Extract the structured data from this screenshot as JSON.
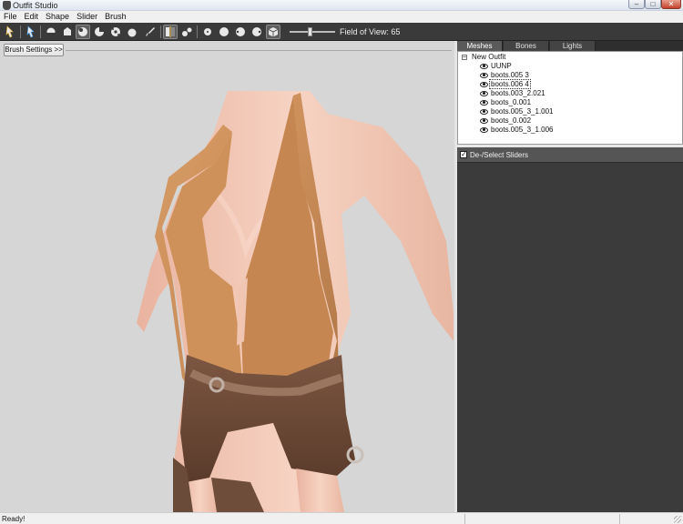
{
  "window": {
    "title": "Outfit Studio",
    "controls": [
      "–",
      "□",
      "✕"
    ]
  },
  "menu": [
    "File",
    "Edit",
    "Shape",
    "Slider",
    "Brush"
  ],
  "toolbar": {
    "fov_label": "Field of View: 65",
    "fov_value": 65
  },
  "viewport": {
    "brush_settings_label": "Brush Settings >>"
  },
  "panel": {
    "tabs": [
      "Meshes",
      "Bones",
      "Lights"
    ],
    "tree_root": "New Outfit",
    "tree_items": [
      "UUNP",
      "boots.005 3",
      "boots.006 4",
      "boots.003_2.021",
      "boots_0.001",
      "boots.005_3_1.001",
      "boots_0.002",
      "boots.005_3_1.006"
    ],
    "selected_item": "boots.006 4",
    "sliders_header": "De-/Select Sliders"
  },
  "status": {
    "text": "Ready!"
  },
  "colors": {
    "toolbar_bg": "#3a3a3a",
    "viewport_bg": "#d6d6d6",
    "slider_panel_bg": "#3b3b3b",
    "skin": "#f2c6b2",
    "top_fabric": "#c98a52",
    "shorts_leather": "#6e4a36"
  }
}
